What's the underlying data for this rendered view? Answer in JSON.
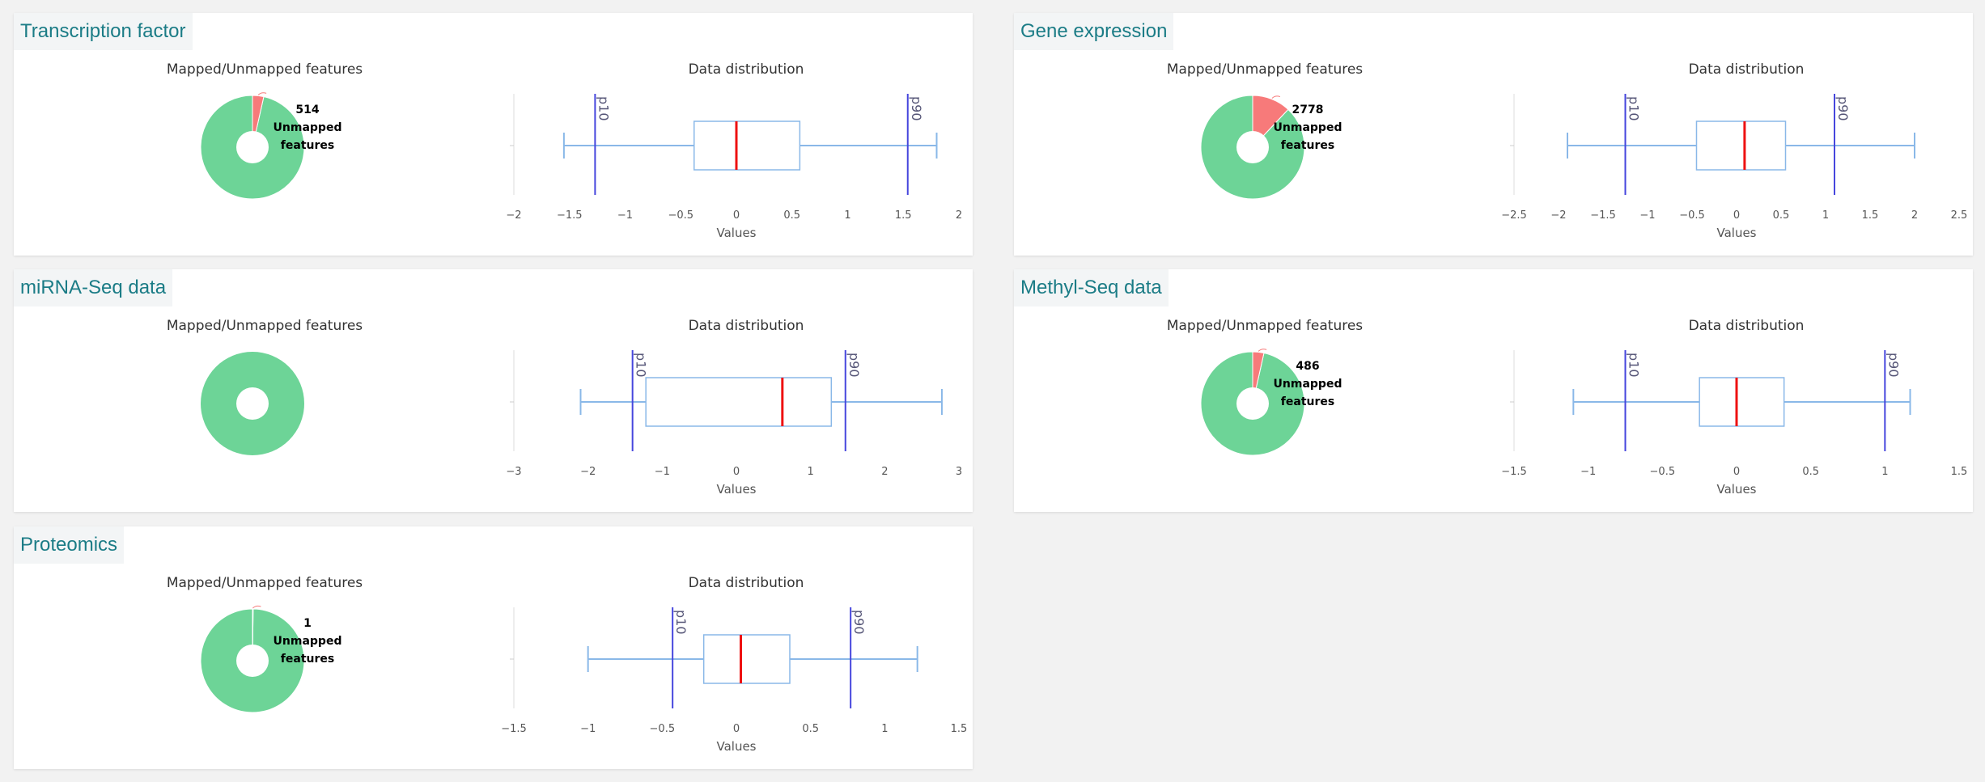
{
  "common": {
    "donut_title": "Mapped/Unmapped features",
    "box_title": "Data distribution",
    "xlabel": "Values",
    "p10_label": "p10",
    "p90_label": "p90",
    "unmapped_label": "Unmapped",
    "features_label": "features"
  },
  "colors": {
    "mapped": "#6dd497",
    "unmapped": "#f77a7a",
    "box_stroke": "#8ab8e8",
    "median": "#ee1111",
    "percentile_line": "#4646dd",
    "title": "#1b7c86"
  },
  "panels": [
    {
      "title": "Transcription factor"
    },
    {
      "title": "Gene expression"
    },
    {
      "title": "miRNA-Seq data"
    },
    {
      "title": "Methyl-Seq data"
    },
    {
      "title": "Proteomics"
    }
  ],
  "chart_data": [
    {
      "type": "pie",
      "panel": "Transcription factor",
      "slices": [
        {
          "label": "Mapped",
          "fraction": 0.965
        },
        {
          "label": "Unmapped",
          "fraction": 0.035,
          "count": "514"
        }
      ],
      "annotation": {
        "count": "514",
        "text": "Unmapped features"
      }
    },
    {
      "type": "box",
      "panel": "Transcription factor",
      "xlabel": "Values",
      "xlim": [
        -2,
        2
      ],
      "ticks": [
        -2,
        -1.5,
        -1,
        -0.5,
        0,
        0.5,
        1,
        1.5,
        2
      ],
      "tick_labels": [
        "−2",
        "−1.5",
        "−1",
        "−0.5",
        "0",
        "0.5",
        "1",
        "1.5",
        "2"
      ],
      "whisker_low": -1.55,
      "q1": -0.38,
      "median": 0.0,
      "q3": 0.57,
      "whisker_high": 1.8,
      "p10": -1.27,
      "p90": 1.54
    },
    {
      "type": "pie",
      "panel": "Gene expression",
      "slices": [
        {
          "label": "Mapped",
          "fraction": 0.88
        },
        {
          "label": "Unmapped",
          "fraction": 0.12,
          "count": "2778"
        }
      ],
      "annotation": {
        "count": "2778",
        "text": "Unmapped features"
      }
    },
    {
      "type": "box",
      "panel": "Gene expression",
      "xlabel": "Values",
      "xlim": [
        -2.5,
        2.5
      ],
      "ticks": [
        -2.5,
        -2,
        -1.5,
        -1,
        -0.5,
        0,
        0.5,
        1,
        1.5,
        2,
        2.5
      ],
      "tick_labels": [
        "−2.5",
        "−2",
        "−1.5",
        "−1",
        "−0.5",
        "0",
        "0.5",
        "1",
        "1.5",
        "2",
        "2.5"
      ],
      "whisker_low": -1.9,
      "q1": -0.45,
      "median": 0.09,
      "q3": 0.55,
      "whisker_high": 2.0,
      "p10": -1.25,
      "p90": 1.1
    },
    {
      "type": "pie",
      "panel": "miRNA-Seq data",
      "slices": [
        {
          "label": "Mapped",
          "fraction": 1.0
        }
      ],
      "annotation": null
    },
    {
      "type": "box",
      "panel": "miRNA-Seq data",
      "xlabel": "Values",
      "xlim": [
        -3,
        3
      ],
      "ticks": [
        -3,
        -2,
        -1,
        0,
        1,
        2,
        3
      ],
      "tick_labels": [
        "−3",
        "−2",
        "−1",
        "0",
        "1",
        "2",
        "3"
      ],
      "whisker_low": -2.1,
      "q1": -1.22,
      "median": 0.62,
      "q3": 1.28,
      "whisker_high": 2.77,
      "p10": -1.4,
      "p90": 1.47
    },
    {
      "type": "pie",
      "panel": "Methyl-Seq data",
      "slices": [
        {
          "label": "Mapped",
          "fraction": 0.965
        },
        {
          "label": "Unmapped",
          "fraction": 0.035,
          "count": "486"
        }
      ],
      "annotation": {
        "count": "486",
        "text": "Unmapped features"
      }
    },
    {
      "type": "box",
      "panel": "Methyl-Seq data",
      "xlabel": "Values",
      "xlim": [
        -1.5,
        1.5
      ],
      "ticks": [
        -1.5,
        -1,
        -0.5,
        0,
        0.5,
        1,
        1.5
      ],
      "tick_labels": [
        "−1.5",
        "−1",
        "−0.5",
        "0",
        "0.5",
        "1",
        "1.5"
      ],
      "whisker_low": -1.1,
      "q1": -0.25,
      "median": 0.0,
      "q3": 0.32,
      "whisker_high": 1.17,
      "p10": -0.75,
      "p90": 1.0
    },
    {
      "type": "pie",
      "panel": "Proteomics",
      "slices": [
        {
          "label": "Mapped",
          "fraction": 0.998
        },
        {
          "label": "Unmapped",
          "fraction": 0.002,
          "count": "1"
        }
      ],
      "annotation": {
        "count": "1",
        "text": "Unmapped features"
      }
    },
    {
      "type": "box",
      "panel": "Proteomics",
      "xlabel": "Values",
      "xlim": [
        -1.5,
        1.5
      ],
      "ticks": [
        -1.5,
        -1,
        -0.5,
        0,
        0.5,
        1,
        1.5
      ],
      "tick_labels": [
        "−1.5",
        "−1",
        "−0.5",
        "0",
        "0.5",
        "1",
        "1.5"
      ],
      "whisker_low": -1.0,
      "q1": -0.22,
      "median": 0.03,
      "q3": 0.36,
      "whisker_high": 1.22,
      "p10": -0.43,
      "p90": 0.77
    }
  ]
}
